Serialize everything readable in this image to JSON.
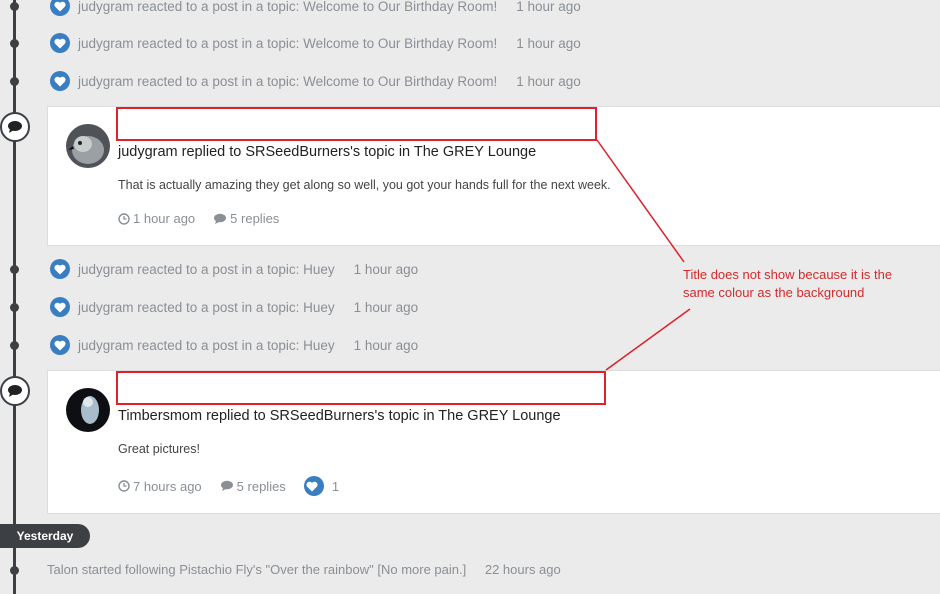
{
  "activity_top": [
    {
      "text": "judygram reacted to a post in a topic: Welcome to Our Birthday Room!",
      "time": "1 hour ago"
    },
    {
      "text": "judygram reacted to a post in a topic: Welcome to Our Birthday Room!",
      "time": "1 hour ago"
    },
    {
      "text": "judygram reacted to a post in a topic: Welcome to Our Birthday Room!",
      "time": "1 hour ago"
    }
  ],
  "card1": {
    "title": "",
    "headline": "judygram replied to SRSeedBurners's topic in The GREY Lounge",
    "body": "That is actually amazing they get along so well, you got your hands full for the next week.",
    "time": "1 hour ago",
    "replies": "5 replies"
  },
  "activity_mid": [
    {
      "text": "judygram reacted to a post in a topic: Huey",
      "time": "1 hour ago"
    },
    {
      "text": "judygram reacted to a post in a topic: Huey",
      "time": "1 hour ago"
    },
    {
      "text": "judygram reacted to a post in a topic: Huey",
      "time": "1 hour ago"
    }
  ],
  "card2": {
    "title": "",
    "headline": "Timbersmom replied to SRSeedBurners's topic in The GREY Lounge",
    "body": "Great pictures!",
    "time": "7 hours ago",
    "replies": "5 replies",
    "reactions": "1"
  },
  "divider": {
    "label": "Yesterday"
  },
  "follow": {
    "text": "Talon started following Pistachio Fly's \"Over the rainbow\" [No more pain.]",
    "time": "22 hours ago"
  },
  "annotation": {
    "text": "Title does not show because it is the same colour as the background",
    "color": "#d42b2b"
  },
  "colors": {
    "timeline": "#3c4045",
    "heart": "#3a7ec2",
    "muted": "#8a8f95"
  }
}
